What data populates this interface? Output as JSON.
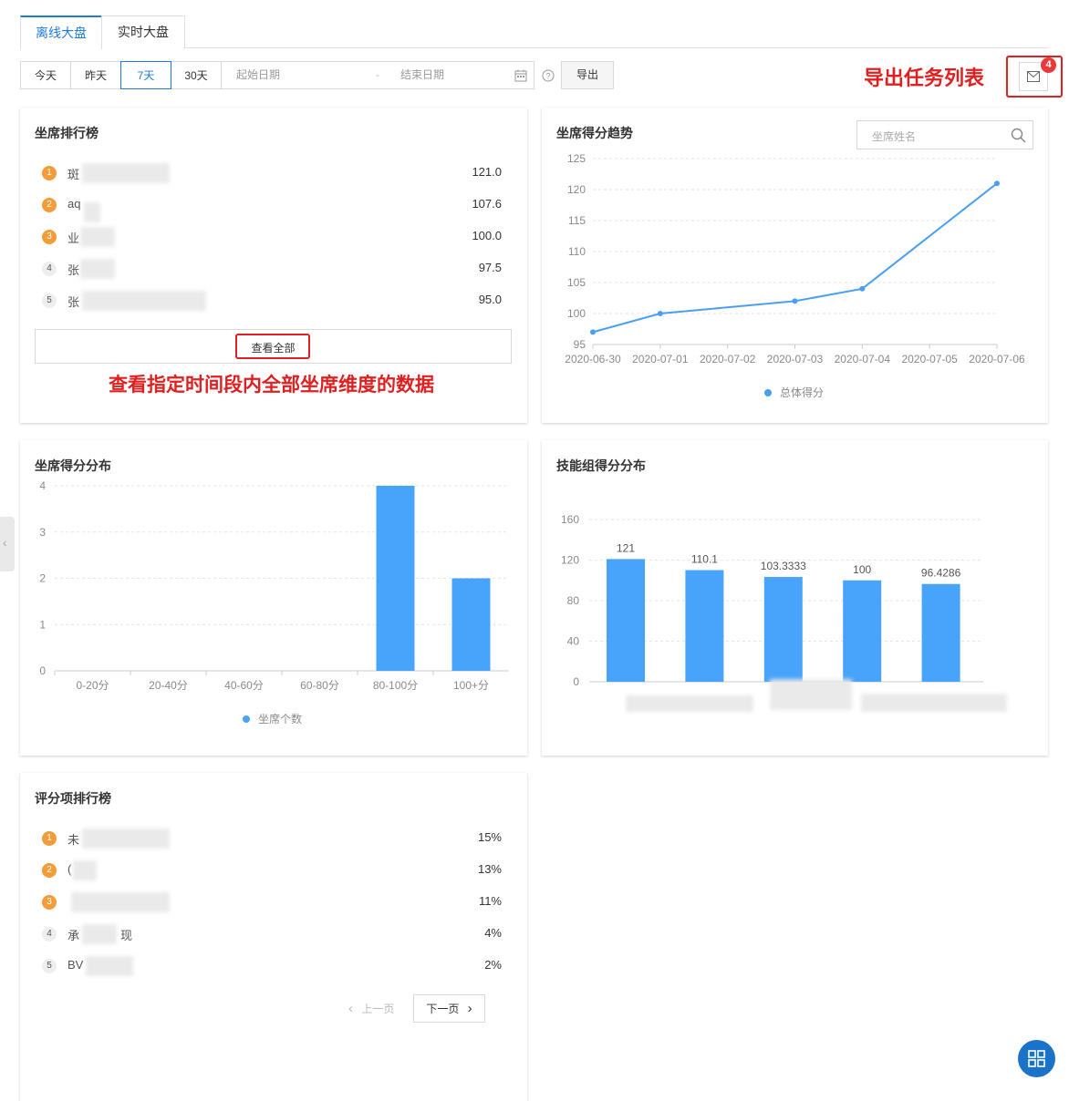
{
  "tabs": [
    {
      "label": "离线大盘",
      "active": true
    },
    {
      "label": "实时大盘",
      "active": false
    }
  ],
  "filters": {
    "ranges": [
      {
        "label": "今天"
      },
      {
        "label": "昨天"
      },
      {
        "label": "7天",
        "active": true
      },
      {
        "label": "30天"
      }
    ],
    "start_placeholder": "起始日期",
    "separator": "-",
    "end_placeholder": "结束日期",
    "export_label": "导出"
  },
  "export_tasks": {
    "badge": "4",
    "annotation": "导出任务列表"
  },
  "agent_ranking": {
    "title": "坐席排行榜",
    "rows": [
      {
        "rank": "1",
        "name": "斑",
        "value": "121.0"
      },
      {
        "rank": "2",
        "name": "aq",
        "value": "107.6"
      },
      {
        "rank": "3",
        "name": "业",
        "value": "100.0"
      },
      {
        "rank": "4",
        "name": "张",
        "value": "97.5"
      },
      {
        "rank": "5",
        "name": "张",
        "value": "95.0"
      }
    ],
    "view_all_label": "查看全部",
    "annotation": "查看指定时间段内全部坐席维度的数据"
  },
  "score_trend": {
    "title": "坐席得分趋势",
    "search_placeholder": "坐席姓名",
    "legend": "总体得分",
    "colors": {
      "line": "#4a9ff5"
    },
    "chart_data": {
      "type": "line",
      "x": [
        "2020-06-30",
        "2020-07-01",
        "2020-07-02",
        "2020-07-03",
        "2020-07-04",
        "2020-07-05",
        "2020-07-06"
      ],
      "points": [
        {
          "x": "2020-06-30",
          "y": 97
        },
        {
          "x": "2020-07-01",
          "y": 100
        },
        {
          "x": "2020-07-03",
          "y": 102
        },
        {
          "x": "2020-07-04",
          "y": 104
        },
        {
          "x": "2020-07-06",
          "y": 121
        }
      ],
      "yticks": [
        "95",
        "100",
        "105",
        "110",
        "115",
        "120",
        "125"
      ],
      "ylim": [
        95,
        125
      ],
      "series": [
        {
          "name": "总体得分"
        }
      ],
      "grid": true
    }
  },
  "score_distribution": {
    "title": "坐席得分分布",
    "legend": "坐席个数",
    "colors": {
      "bar": "#48a4fa"
    },
    "chart_data": {
      "type": "bar",
      "categories": [
        "0-20分",
        "20-40分",
        "40-60分",
        "60-80分",
        "80-100分",
        "100+分"
      ],
      "values": [
        0,
        0,
        0,
        0,
        4,
        2
      ],
      "yticks": [
        "0",
        "1",
        "2",
        "3",
        "4"
      ],
      "ylim": [
        0,
        4
      ],
      "series": [
        {
          "name": "坐席个数"
        }
      ],
      "grid": true
    }
  },
  "skill_group_distribution": {
    "title": "技能组得分分布",
    "colors": {
      "bar": "#48a4fa"
    },
    "chart_data": {
      "type": "bar",
      "categories": [
        "",
        "",
        "",
        "",
        ""
      ],
      "values": [
        121,
        110.1,
        103.3333,
        100,
        96.4286
      ],
      "labels": [
        "121",
        "110.1",
        "103.3333",
        "100",
        "96.4286"
      ],
      "yticks": [
        "0",
        "40",
        "80",
        "120",
        "160"
      ],
      "ylim": [
        0,
        160
      ],
      "grid": true
    }
  },
  "item_ranking": {
    "title": "评分项排行榜",
    "rows": [
      {
        "rank": "1",
        "name": "未",
        "value": "15%"
      },
      {
        "rank": "2",
        "name": "(",
        "value": "13%"
      },
      {
        "rank": "3",
        "name": "",
        "value": "11%"
      },
      {
        "rank": "4",
        "name": "承",
        "name_suffix": "现",
        "value": "4%"
      },
      {
        "rank": "5",
        "name": "BV",
        "value": "2%"
      }
    ],
    "pager": {
      "prev": "上一页",
      "next": "下一页"
    }
  }
}
